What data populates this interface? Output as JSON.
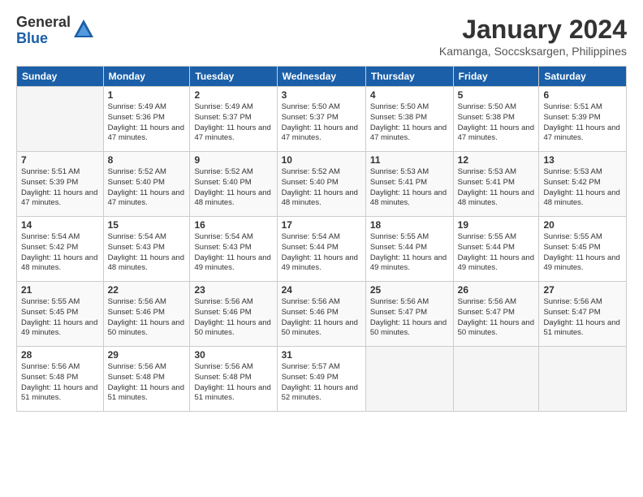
{
  "logo": {
    "general": "General",
    "blue": "Blue"
  },
  "title": "January 2024",
  "location": "Kamanga, Soccsksargen, Philippines",
  "days_of_week": [
    "Sunday",
    "Monday",
    "Tuesday",
    "Wednesday",
    "Thursday",
    "Friday",
    "Saturday"
  ],
  "weeks": [
    [
      {
        "num": "",
        "empty": true
      },
      {
        "num": "1",
        "rise": "5:49 AM",
        "set": "5:36 PM",
        "daylight": "11 hours and 47 minutes."
      },
      {
        "num": "2",
        "rise": "5:49 AM",
        "set": "5:37 PM",
        "daylight": "11 hours and 47 minutes."
      },
      {
        "num": "3",
        "rise": "5:50 AM",
        "set": "5:37 PM",
        "daylight": "11 hours and 47 minutes."
      },
      {
        "num": "4",
        "rise": "5:50 AM",
        "set": "5:38 PM",
        "daylight": "11 hours and 47 minutes."
      },
      {
        "num": "5",
        "rise": "5:50 AM",
        "set": "5:38 PM",
        "daylight": "11 hours and 47 minutes."
      },
      {
        "num": "6",
        "rise": "5:51 AM",
        "set": "5:39 PM",
        "daylight": "11 hours and 47 minutes."
      }
    ],
    [
      {
        "num": "7",
        "rise": "5:51 AM",
        "set": "5:39 PM",
        "daylight": "11 hours and 47 minutes."
      },
      {
        "num": "8",
        "rise": "5:52 AM",
        "set": "5:40 PM",
        "daylight": "11 hours and 47 minutes."
      },
      {
        "num": "9",
        "rise": "5:52 AM",
        "set": "5:40 PM",
        "daylight": "11 hours and 48 minutes."
      },
      {
        "num": "10",
        "rise": "5:52 AM",
        "set": "5:40 PM",
        "daylight": "11 hours and 48 minutes."
      },
      {
        "num": "11",
        "rise": "5:53 AM",
        "set": "5:41 PM",
        "daylight": "11 hours and 48 minutes."
      },
      {
        "num": "12",
        "rise": "5:53 AM",
        "set": "5:41 PM",
        "daylight": "11 hours and 48 minutes."
      },
      {
        "num": "13",
        "rise": "5:53 AM",
        "set": "5:42 PM",
        "daylight": "11 hours and 48 minutes."
      }
    ],
    [
      {
        "num": "14",
        "rise": "5:54 AM",
        "set": "5:42 PM",
        "daylight": "11 hours and 48 minutes."
      },
      {
        "num": "15",
        "rise": "5:54 AM",
        "set": "5:43 PM",
        "daylight": "11 hours and 48 minutes."
      },
      {
        "num": "16",
        "rise": "5:54 AM",
        "set": "5:43 PM",
        "daylight": "11 hours and 49 minutes."
      },
      {
        "num": "17",
        "rise": "5:54 AM",
        "set": "5:44 PM",
        "daylight": "11 hours and 49 minutes."
      },
      {
        "num": "18",
        "rise": "5:55 AM",
        "set": "5:44 PM",
        "daylight": "11 hours and 49 minutes."
      },
      {
        "num": "19",
        "rise": "5:55 AM",
        "set": "5:44 PM",
        "daylight": "11 hours and 49 minutes."
      },
      {
        "num": "20",
        "rise": "5:55 AM",
        "set": "5:45 PM",
        "daylight": "11 hours and 49 minutes."
      }
    ],
    [
      {
        "num": "21",
        "rise": "5:55 AM",
        "set": "5:45 PM",
        "daylight": "11 hours and 49 minutes."
      },
      {
        "num": "22",
        "rise": "5:56 AM",
        "set": "5:46 PM",
        "daylight": "11 hours and 50 minutes."
      },
      {
        "num": "23",
        "rise": "5:56 AM",
        "set": "5:46 PM",
        "daylight": "11 hours and 50 minutes."
      },
      {
        "num": "24",
        "rise": "5:56 AM",
        "set": "5:46 PM",
        "daylight": "11 hours and 50 minutes."
      },
      {
        "num": "25",
        "rise": "5:56 AM",
        "set": "5:47 PM",
        "daylight": "11 hours and 50 minutes."
      },
      {
        "num": "26",
        "rise": "5:56 AM",
        "set": "5:47 PM",
        "daylight": "11 hours and 50 minutes."
      },
      {
        "num": "27",
        "rise": "5:56 AM",
        "set": "5:47 PM",
        "daylight": "11 hours and 51 minutes."
      }
    ],
    [
      {
        "num": "28",
        "rise": "5:56 AM",
        "set": "5:48 PM",
        "daylight": "11 hours and 51 minutes."
      },
      {
        "num": "29",
        "rise": "5:56 AM",
        "set": "5:48 PM",
        "daylight": "11 hours and 51 minutes."
      },
      {
        "num": "30",
        "rise": "5:56 AM",
        "set": "5:48 PM",
        "daylight": "11 hours and 51 minutes."
      },
      {
        "num": "31",
        "rise": "5:57 AM",
        "set": "5:49 PM",
        "daylight": "11 hours and 52 minutes."
      },
      {
        "num": "",
        "empty": true
      },
      {
        "num": "",
        "empty": true
      },
      {
        "num": "",
        "empty": true
      }
    ]
  ]
}
